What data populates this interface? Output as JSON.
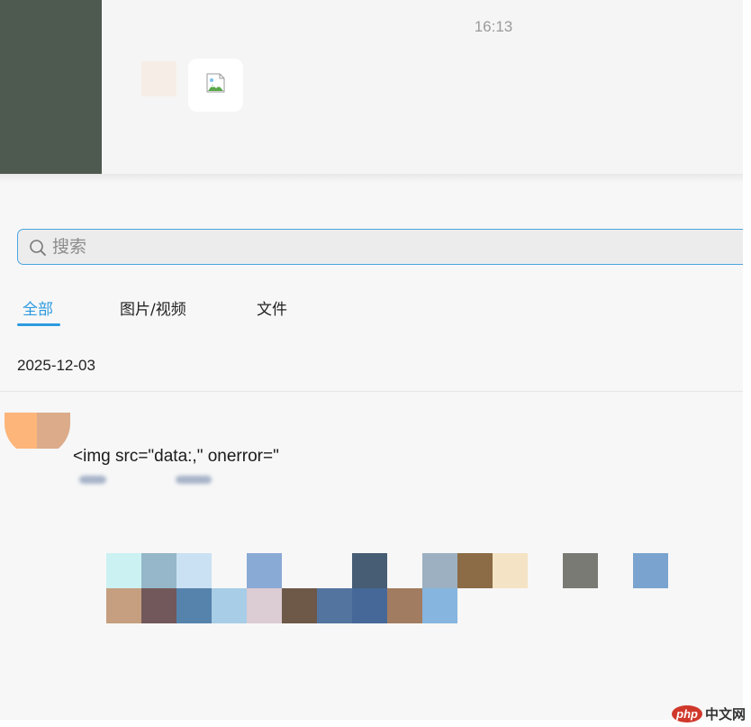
{
  "chat": {
    "time": "16:13",
    "sidebar_color": "#4e5a50"
  },
  "search": {
    "placeholder": "搜索"
  },
  "tabs": [
    {
      "label": "全部",
      "active": true
    },
    {
      "label": "图片/视频",
      "active": false
    },
    {
      "label": "文件",
      "active": false
    }
  ],
  "history": {
    "date": "2025-12-03",
    "message": {
      "text": "<img src=\"data:,\" onerror=\"",
      "avatar_colors": [
        "#fdb57a",
        "#dcab8a"
      ]
    }
  },
  "mosaic": {
    "rows": [
      [
        "#cbf1f3",
        "#95b7c9",
        "#cae1f3",
        "",
        "#8aaad6",
        "",
        "",
        "#465d74",
        "",
        "#9cb0c1",
        "#8b6c46",
        "#f5e3c5",
        "",
        "#7a7a74",
        "",
        "#7aa4cf"
      ],
      [
        "#c59f7f",
        "#72585a",
        "#5683ac",
        "#a8cde6",
        "#dcccd3",
        "#6e5848",
        "#5474a0",
        "#466898",
        "#a27c60",
        "#86b5e0"
      ]
    ]
  },
  "watermark": {
    "logo": "php",
    "text": "中文网"
  },
  "accent_color": "#2d9ae0"
}
